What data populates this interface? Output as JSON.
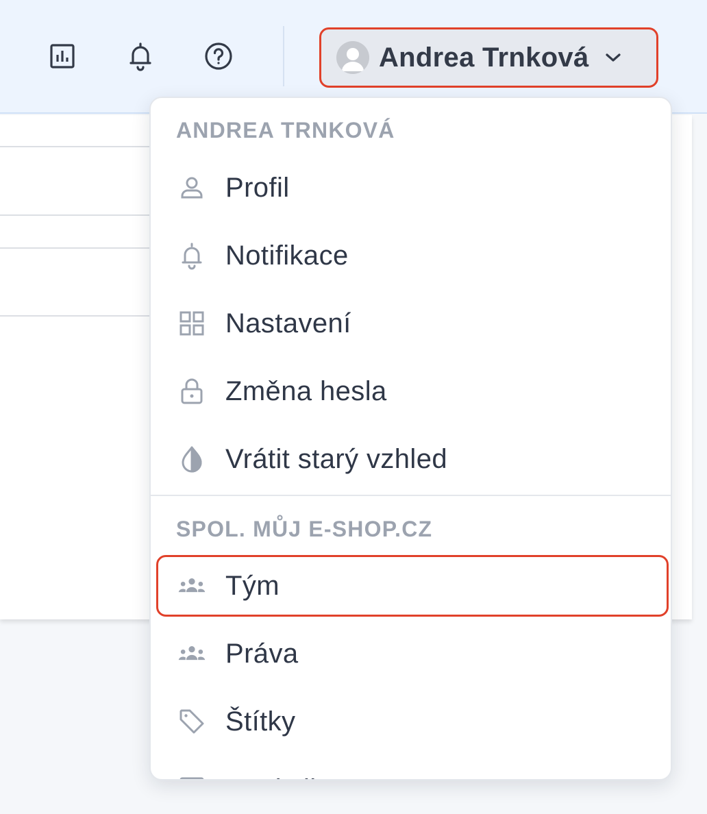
{
  "header": {
    "icons": [
      "bar-chart-icon",
      "bell-icon",
      "help-circle-icon"
    ],
    "user": {
      "name": "Andrea Trnková"
    }
  },
  "dropdown": {
    "user_section": {
      "heading": "ANDREA TRNKOVÁ",
      "items": [
        {
          "label": "Profil",
          "icon": "user-icon"
        },
        {
          "label": "Notifikace",
          "icon": "bell-icon"
        },
        {
          "label": "Nastavení",
          "icon": "grid-icon"
        },
        {
          "label": "Změna hesla",
          "icon": "lock-icon"
        },
        {
          "label": "Vrátit starý vzhled",
          "icon": "contrast-icon"
        }
      ]
    },
    "company_section": {
      "heading": "SPOL. MŮJ E-SHOP.CZ",
      "items": [
        {
          "label": "Tým",
          "icon": "team-icon",
          "highlighted": true
        },
        {
          "label": "Práva",
          "icon": "team-icon"
        },
        {
          "label": "Štítky",
          "icon": "tag-icon"
        },
        {
          "label": "Statistiky",
          "icon": "chart-icon"
        }
      ]
    }
  },
  "colors": {
    "highlight_border": "#e1412a",
    "topbar_bg": "#edf4fe",
    "icon_gray": "#9ca3af",
    "text_dark": "#2f3747"
  }
}
